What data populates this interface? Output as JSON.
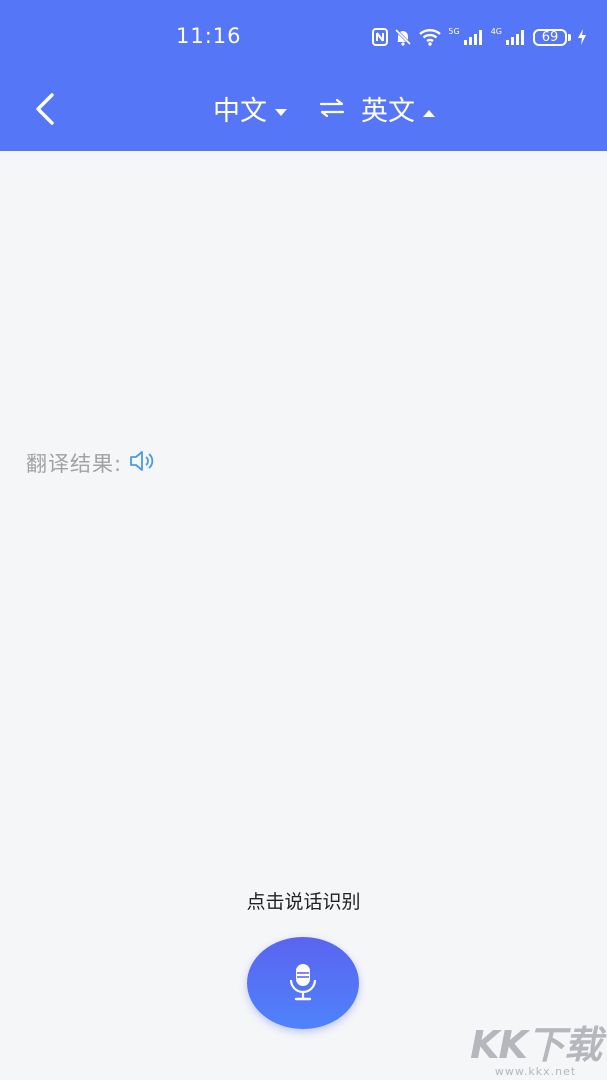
{
  "status_bar": {
    "time": "11:16",
    "net_5g": "5G",
    "net_4g": "4G",
    "battery": "69"
  },
  "nav": {
    "source_lang": "中文",
    "target_lang": "英文"
  },
  "result": {
    "label": "翻译结果:"
  },
  "voice": {
    "hint": "点击说话识别"
  },
  "watermark": {
    "logo": "KK下载",
    "url": "www.kkx.net"
  },
  "colors": {
    "header": "#5676f8",
    "background": "#f5f6f8",
    "speaker": "#4a9be0",
    "mic_gradient_top": "#5a64f0",
    "mic_gradient_bottom": "#4f82fb"
  }
}
